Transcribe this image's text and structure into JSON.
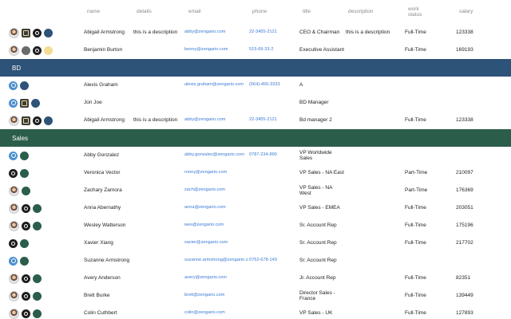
{
  "headers": {
    "name": "name",
    "details": "details",
    "email": "email",
    "phone": "phone",
    "title": "title",
    "description": "description",
    "work_status": "work status",
    "salary": "salary"
  },
  "rows": [
    {
      "type": "person",
      "icons": [
        "avatar-photo",
        "square",
        "tool",
        "blue-dot"
      ],
      "name": "Abigail Armstrong",
      "details": "this is a description",
      "email": "abby@zengario.com",
      "phone": "22-3455-2121",
      "title": "CEO & Chairman",
      "description": "this is a description",
      "work_status": "Full-Time",
      "salary": "123338"
    },
    {
      "type": "person",
      "icons": [
        "avatar-photo",
        "gray",
        "tool",
        "yellow-dot"
      ],
      "name": "Benjamin Burton",
      "details": "",
      "email": "benny@zengario.com",
      "phone": "515-69-33-2",
      "title": "Executive Assistant",
      "description": "",
      "work_status": "Full-Time",
      "salary": "169193"
    },
    {
      "type": "group",
      "label": "BD",
      "color": "blue"
    },
    {
      "type": "person",
      "icons": [
        "user-ph",
        "blue-dot"
      ],
      "name": "Alexis Graham",
      "details": "",
      "email": "alexis.graham@zengario.com",
      "phone": "(564)-456-3333",
      "title": "A",
      "description": "",
      "work_status": "",
      "salary": ""
    },
    {
      "type": "person",
      "icons": [
        "user-ph",
        "square",
        "blue-dot"
      ],
      "name": "Jon Joe",
      "details": "",
      "email": "",
      "phone": "",
      "title": "BD Manager",
      "description": "",
      "work_status": "",
      "salary": ""
    },
    {
      "type": "person",
      "icons": [
        "avatar-photo",
        "square",
        "tool",
        "blue-dot"
      ],
      "name": "Abigail Armstrong",
      "details": "this is a description",
      "email": "abby@zengario.com",
      "phone": "22-3455-2121",
      "title": "Bd manager 2",
      "description": "",
      "work_status": "Full-Time",
      "salary": "123338"
    },
    {
      "type": "group",
      "label": "Sales",
      "color": "green"
    },
    {
      "type": "person",
      "icons": [
        "user-ph",
        "green-dot"
      ],
      "name": "Abby Gonzalez",
      "details": "",
      "email": "abby.gonzalez@zengario.com",
      "phone": "0787-234-890",
      "title": "VP Worldwide Sales",
      "description": "",
      "work_status": "",
      "salary": ""
    },
    {
      "type": "person",
      "icons": [
        "tool",
        "green-dot"
      ],
      "name": "Veronica Vector",
      "details": "",
      "email": "ronny@zengario.com",
      "phone": "",
      "title": "VP Sales - NA East",
      "description": "",
      "work_status": "Part-Time",
      "salary": "210097"
    },
    {
      "type": "person",
      "icons": [
        "avatar-photo",
        "green-dot"
      ],
      "name": "Zachary Zamora",
      "details": "",
      "email": "zach@zengario.com",
      "phone": "",
      "title": "VP Sales - NA West",
      "description": "",
      "work_status": "Part-Time",
      "salary": "176369"
    },
    {
      "type": "person",
      "icons": [
        "avatar-photo",
        "tool",
        "green-dot"
      ],
      "name": "Anna Abernathy",
      "details": "",
      "email": "anna@zengario.com",
      "phone": "",
      "title": "VP Sales - EMEA",
      "description": "",
      "work_status": "Full-Time",
      "salary": "203051"
    },
    {
      "type": "person",
      "icons": [
        "avatar-photo",
        "tool",
        "green-dot"
      ],
      "name": "Wesley Watterson",
      "details": "",
      "email": "wes@zengario.com",
      "phone": "",
      "title": "Sr. Account Rep",
      "description": "",
      "work_status": "Full-Time",
      "salary": "175196"
    },
    {
      "type": "person",
      "icons": [
        "tool",
        "green-dot"
      ],
      "name": "Xavier Xiang",
      "details": "",
      "email": "xavier@zengario.com",
      "phone": "",
      "title": "Sr. Account Rep",
      "description": "",
      "work_status": "Full-Time",
      "salary": "217702"
    },
    {
      "type": "person",
      "icons": [
        "user-ph",
        "green-dot"
      ],
      "name": "Suzanne Armstrong",
      "details": "",
      "email": "suzanne.armstrong@zengario.com",
      "phone": "0762-678-149",
      "title": "Sr. Account Rep",
      "description": "",
      "work_status": "",
      "salary": ""
    },
    {
      "type": "person",
      "icons": [
        "avatar-photo",
        "tool",
        "green-dot"
      ],
      "name": "Avery Anderson",
      "details": "",
      "email": "avery@zengario.com",
      "phone": "",
      "title": "Jr. Account Rep",
      "description": "",
      "work_status": "Full-Time",
      "salary": "82351"
    },
    {
      "type": "person",
      "icons": [
        "avatar-photo",
        "tool",
        "green-dot"
      ],
      "name": "Brett Burke",
      "details": "",
      "email": "brett@zengario.com",
      "phone": "",
      "title": "Director Sales - France",
      "description": "",
      "work_status": "Full-Time",
      "salary": "139449"
    },
    {
      "type": "person",
      "icons": [
        "avatar-photo",
        "tool",
        "green-dot"
      ],
      "name": "Colin Cuthbert",
      "details": "",
      "email": "colin@zengario.com",
      "phone": "",
      "title": "VP Sales - UK",
      "description": "",
      "work_status": "Full-Time",
      "salary": "127893"
    }
  ],
  "colors": {
    "accent_blue": "#2d5378",
    "accent_green": "#2b5d4b",
    "link": "#3a7bd5"
  }
}
